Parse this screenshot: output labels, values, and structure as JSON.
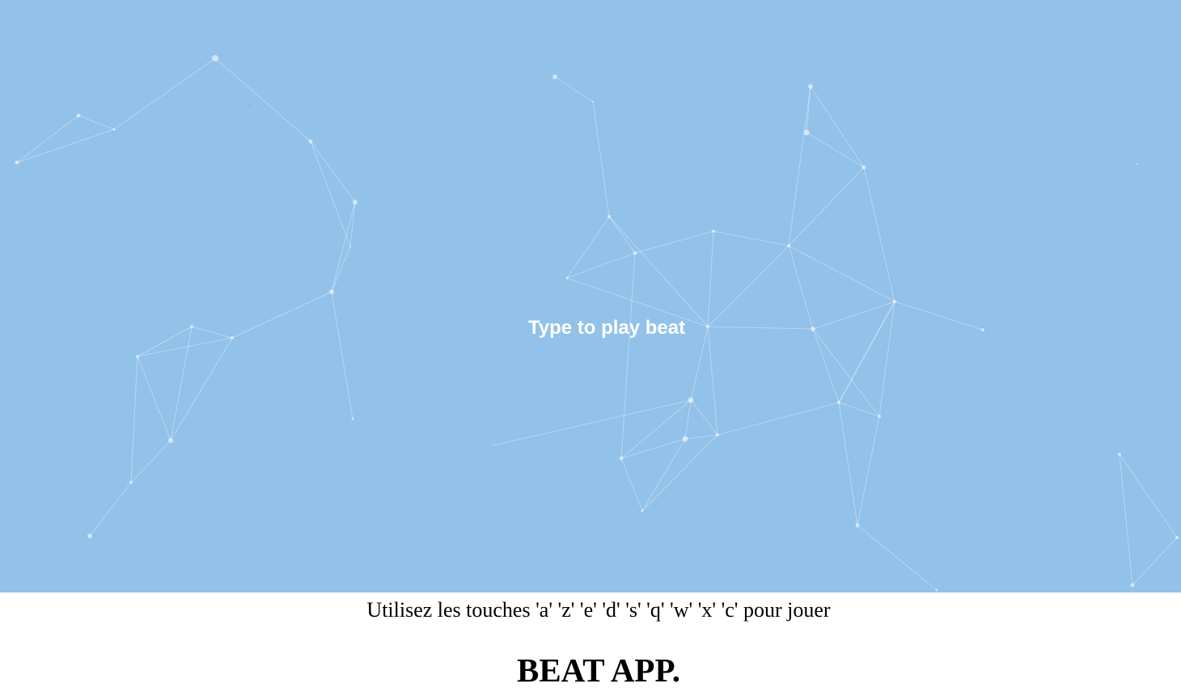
{
  "background": {
    "color": "#92c1ea",
    "pattern": "particle-network"
  },
  "stage": {
    "prompt": "Type to play beat"
  },
  "instructions": {
    "text": "Utilisez les touches 'a' 'z' 'e' 'd' 's' 'q' 'w' 'x' 'c' pour jouer"
  },
  "app": {
    "title": "BEAT APP."
  },
  "colors": {
    "particle": "#ffffff",
    "background": "#92c1ea",
    "text_light": "#ffffff",
    "text_dark": "#000000"
  }
}
